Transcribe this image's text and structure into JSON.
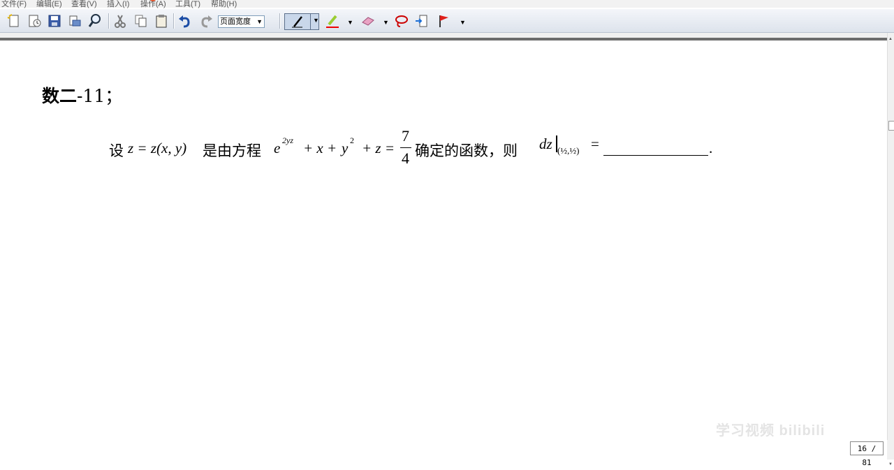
{
  "menu": {
    "items": [
      "文件(F)",
      "编辑(E)",
      "查看(V)",
      "插入(I)",
      "操作(A)",
      "工具(T)",
      "帮助(H)"
    ]
  },
  "toolbar": {
    "zoom_value": "页面宽度",
    "icons": [
      "new-icon",
      "open-icon",
      "save-icon",
      "print-icon",
      "find-icon",
      "cut-icon",
      "copy-icon",
      "paste-icon",
      "undo-icon",
      "redo-icon",
      "pen-icon",
      "highlighter-icon",
      "eraser-icon",
      "lasso-icon",
      "insert-space-icon",
      "flag-icon"
    ]
  },
  "document": {
    "heading_bold": "数二",
    "heading_rest": "-11；",
    "problem": {
      "p1": "设",
      "eq1": "z = z(x, y)",
      "p2": "是由方程",
      "e": "e",
      "exp": "2yz",
      "plus_x": "+ x + ",
      "y": "y",
      "sq": "2",
      "plus_z": "+ z =",
      "num": "7",
      "den": "4",
      "p3": "确定的函数，则",
      "dz": "dz",
      "sub": "(½,½)",
      "eq": "=",
      "end": "."
    }
  },
  "status": {
    "page_indicator": "16 / 81",
    "watermark": "学习视频 bilibili"
  },
  "colors": {
    "toolbar_bg": "#dde3ec",
    "highlight_red": "#e8542a"
  }
}
